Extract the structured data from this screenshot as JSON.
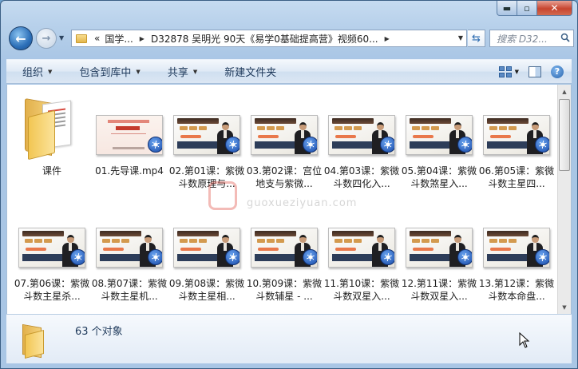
{
  "address": {
    "overflow": "«",
    "segments": [
      "国学...",
      "D32878 吴明光 90天《易学0基础提高营》视频60..."
    ]
  },
  "search": {
    "placeholder": "搜索 D32..."
  },
  "toolbar": {
    "organize": "组织",
    "include_library": "包含到库中",
    "share": "共享",
    "new_folder": "新建文件夹"
  },
  "items": [
    {
      "type": "folder",
      "label": "课件"
    },
    {
      "type": "video-intro",
      "label": "01.先导课.mp4"
    },
    {
      "type": "video",
      "label": "02.第01课：紫微斗数原理与..."
    },
    {
      "type": "video",
      "label": "03.第02课：宫位地支与紫微..."
    },
    {
      "type": "video",
      "label": "04.第03课：紫微斗数四化入..."
    },
    {
      "type": "video",
      "label": "05.第04课：紫微斗数煞星入..."
    },
    {
      "type": "video",
      "label": "06.第05课：紫微斗数主星四..."
    },
    {
      "type": "video",
      "label": "07.第06课：紫微斗数主星杀..."
    },
    {
      "type": "video",
      "label": "08.第07课：紫微斗数主星机..."
    },
    {
      "type": "video",
      "label": "09.第08课：紫微斗数主星相..."
    },
    {
      "type": "video",
      "label": "10.第09课：紫微斗数辅星 - ..."
    },
    {
      "type": "video",
      "label": "11.第10课：紫微斗数双星入..."
    },
    {
      "type": "video",
      "label": "12.第11课：紫微斗数双星入..."
    },
    {
      "type": "video",
      "label": "13.第12课：紫微斗数本命盘..."
    }
  ],
  "watermark": {
    "text": "guoxueziyuan.com"
  },
  "status": {
    "count": "63 个对象"
  }
}
